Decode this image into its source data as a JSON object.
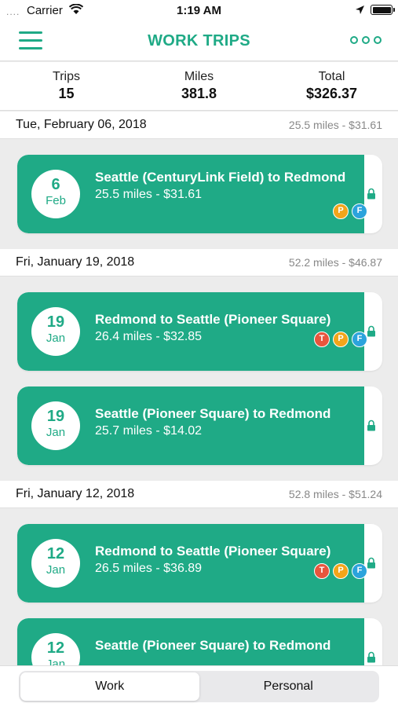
{
  "status_bar": {
    "carrier": "Carrier",
    "time": "1:19 AM",
    "signal_dots": "....",
    "battery_level": 1.0
  },
  "nav": {
    "title": "WORK TRIPS",
    "menu_icon": "hamburger-menu-icon",
    "more_icon": "more-dots-icon"
  },
  "summary": [
    {
      "label": "Trips",
      "value": "15"
    },
    {
      "label": "Miles",
      "value": "381.8"
    },
    {
      "label": "Total",
      "value": "$326.37"
    }
  ],
  "days": [
    {
      "date": "Tue, February 06, 2018",
      "summary": "25.5 miles - $31.61",
      "trips": [
        {
          "day": "6",
          "month": "Feb",
          "route": "Seattle (CenturyLink Field) to Redmond",
          "detail": "25.5 miles - $31.61",
          "badges": [
            "P",
            "F"
          ]
        }
      ]
    },
    {
      "date": "Fri, January 19, 2018",
      "summary": "52.2 miles - $46.87",
      "trips": [
        {
          "day": "19",
          "month": "Jan",
          "route": "Redmond to Seattle (Pioneer Square)",
          "detail": "26.4 miles - $32.85",
          "badges": [
            "T",
            "P",
            "F"
          ]
        },
        {
          "day": "19",
          "month": "Jan",
          "route": "Seattle (Pioneer Square) to Redmond",
          "detail": "25.7 miles - $14.02",
          "badges": []
        }
      ]
    },
    {
      "date": "Fri, January 12, 2018",
      "summary": "52.8 miles - $51.24",
      "trips": [
        {
          "day": "12",
          "month": "Jan",
          "route": "Redmond to Seattle (Pioneer Square)",
          "detail": "26.5 miles - $36.89",
          "badges": [
            "T",
            "P",
            "F"
          ]
        },
        {
          "day": "12",
          "month": "Jan",
          "route": "Seattle (Pioneer Square) to Redmond",
          "detail": "",
          "badges": []
        }
      ]
    }
  ],
  "segments": [
    {
      "label": "Work",
      "active": true
    },
    {
      "label": "Personal",
      "active": false
    }
  ],
  "colors": {
    "accent": "#1faa86",
    "toll": "#e8553d",
    "parking": "#f2a51a",
    "ferry": "#2ba3dc"
  }
}
